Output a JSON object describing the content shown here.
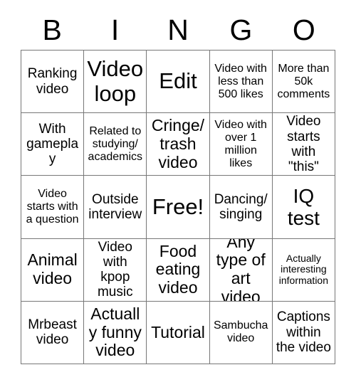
{
  "card": {
    "title_letters": [
      "B",
      "I",
      "N",
      "G",
      "O"
    ],
    "columns": 5,
    "rows": 5,
    "free_space_label": "Free!",
    "free_space_position": [
      2,
      2
    ],
    "border_color": "#777777",
    "text_color": "#000000",
    "background_color": "#ffffff",
    "cells": [
      [
        {
          "text": "Ranking video",
          "size": "md"
        },
        {
          "text": "Video loop",
          "size": "xxl"
        },
        {
          "text": "Edit",
          "size": "xxl"
        },
        {
          "text": "Video with less than 500 likes",
          "size": "sm"
        },
        {
          "text": "More than 50k comments",
          "size": "sm"
        }
      ],
      [
        {
          "text": "With gameplay",
          "size": "md"
        },
        {
          "text": "Related to studying/ academics",
          "size": "sm"
        },
        {
          "text": "Cringe/ trash video",
          "size": "lg"
        },
        {
          "text": "Video with over 1 million likes",
          "size": "sm"
        },
        {
          "text": "Video starts with \"this\"",
          "size": "md"
        }
      ],
      [
        {
          "text": "Video starts with a question",
          "size": "sm"
        },
        {
          "text": "Outside interview",
          "size": "md"
        },
        {
          "text": "Free!",
          "size": "xxl"
        },
        {
          "text": "Dancing/ singing",
          "size": "md"
        },
        {
          "text": "IQ test",
          "size": "xl"
        }
      ],
      [
        {
          "text": "Animal video",
          "size": "lg"
        },
        {
          "text": "Video with kpop music",
          "size": "md"
        },
        {
          "text": "Food eating video",
          "size": "lg"
        },
        {
          "text": "Any type of art video",
          "size": "lg"
        },
        {
          "text": "Actually interesting information",
          "size": "xs"
        }
      ],
      [
        {
          "text": "Mrbeast video",
          "size": "md"
        },
        {
          "text": "Actually funny video",
          "size": "lg"
        },
        {
          "text": "Tutorial",
          "size": "lg"
        },
        {
          "text": "Sambucha video",
          "size": "sm"
        },
        {
          "text": "Captions within the video",
          "size": "md"
        }
      ]
    ]
  }
}
